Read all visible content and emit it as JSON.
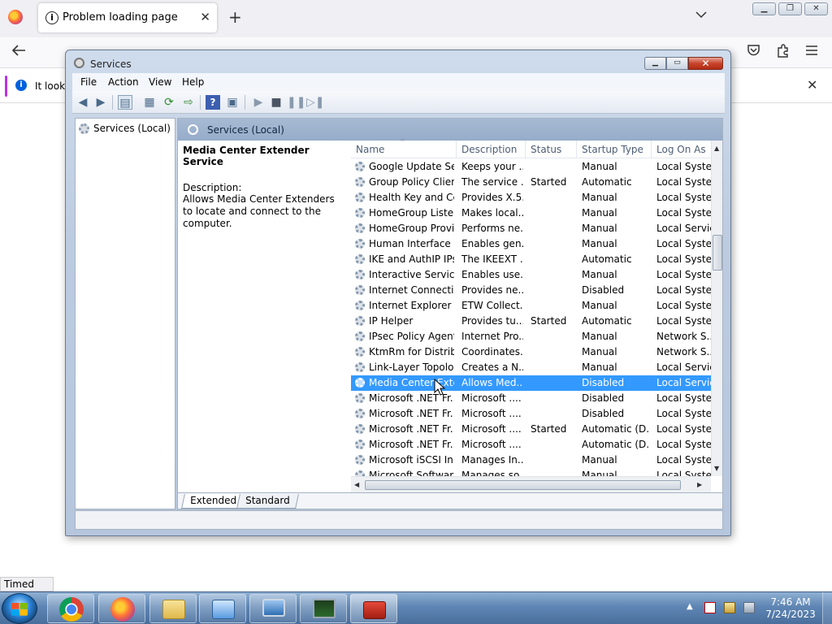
{
  "firefox": {
    "tab_title": "Problem loading page",
    "tab_close": "✕",
    "new_tab": "+",
    "notice_text": "It looks",
    "status_text": "Timed Out"
  },
  "window_buttons": {
    "minimize": "▁",
    "maximize": "❐",
    "close": "✕"
  },
  "services_window": {
    "title": "Services",
    "caption": {
      "minimize": "▁",
      "maximize": "▭",
      "close": "✕"
    },
    "menu": [
      "File",
      "Action",
      "View",
      "Help"
    ],
    "tree_item": "Services (Local)",
    "panel_header": "Services (Local)",
    "selected_service": {
      "name": "Media Center Extender Service",
      "description_label": "Description:",
      "description": "Allows Media Center Extenders to locate and connect to the computer."
    },
    "columns": [
      "Name",
      "Description",
      "Status",
      "Startup Type",
      "Log On As"
    ],
    "rows": [
      {
        "name": "Google Update Se...",
        "description": "Keeps your ...",
        "status": "",
        "startup": "Manual",
        "logon": "Local Syste..."
      },
      {
        "name": "Group Policy Client",
        "description": "The service ...",
        "status": "Started",
        "startup": "Automatic",
        "logon": "Local Syste..."
      },
      {
        "name": "Health Key and Ce...",
        "description": "Provides X.5...",
        "status": "",
        "startup": "Manual",
        "logon": "Local Syste..."
      },
      {
        "name": "HomeGroup Liste...",
        "description": "Makes local...",
        "status": "",
        "startup": "Manual",
        "logon": "Local Syste..."
      },
      {
        "name": "HomeGroup Provi...",
        "description": "Performs ne...",
        "status": "",
        "startup": "Manual",
        "logon": "Local Servic"
      },
      {
        "name": "Human Interface ...",
        "description": "Enables gen...",
        "status": "",
        "startup": "Manual",
        "logon": "Local Syste..."
      },
      {
        "name": "IKE and AuthIP IPs...",
        "description": "The IKEEXT ...",
        "status": "",
        "startup": "Automatic",
        "logon": "Local Syste..."
      },
      {
        "name": "Interactive Service...",
        "description": "Enables use...",
        "status": "",
        "startup": "Manual",
        "logon": "Local Syste..."
      },
      {
        "name": "Internet Connecti...",
        "description": "Provides ne...",
        "status": "",
        "startup": "Disabled",
        "logon": "Local Syste..."
      },
      {
        "name": "Internet Explorer E...",
        "description": "ETW Collect...",
        "status": "",
        "startup": "Manual",
        "logon": "Local Syste..."
      },
      {
        "name": "IP Helper",
        "description": "Provides tu...",
        "status": "Started",
        "startup": "Automatic",
        "logon": "Local Syste..."
      },
      {
        "name": "IPsec Policy Agent",
        "description": "Internet Pro...",
        "status": "",
        "startup": "Manual",
        "logon": "Network S..."
      },
      {
        "name": "KtmRm for Distrib...",
        "description": "Coordinates...",
        "status": "",
        "startup": "Manual",
        "logon": "Network S..."
      },
      {
        "name": "Link-Layer Topolo...",
        "description": "Creates a N...",
        "status": "",
        "startup": "Manual",
        "logon": "Local Servic"
      },
      {
        "name": "Media Center Exte...",
        "description": "Allows Med...",
        "status": "",
        "startup": "Disabled",
        "logon": "Local Servic",
        "selected": true
      },
      {
        "name": "Microsoft .NET Fr...",
        "description": "Microsoft ....",
        "status": "",
        "startup": "Disabled",
        "logon": "Local Syste..."
      },
      {
        "name": "Microsoft .NET Fr...",
        "description": "Microsoft ....",
        "status": "",
        "startup": "Disabled",
        "logon": "Local Syste..."
      },
      {
        "name": "Microsoft .NET Fr...",
        "description": "Microsoft ....",
        "status": "Started",
        "startup": "Automatic (D...",
        "logon": "Local Syste..."
      },
      {
        "name": "Microsoft .NET Fr...",
        "description": "Microsoft ....",
        "status": "",
        "startup": "Automatic (D...",
        "logon": "Local Syste..."
      },
      {
        "name": "Microsoft iSCSI Ini...",
        "description": "Manages In...",
        "status": "",
        "startup": "Manual",
        "logon": "Local Syste..."
      },
      {
        "name": "Microsoft Softwar...",
        "description": "Manages so...",
        "status": "",
        "startup": "Manual",
        "logon": "Local Syste..."
      }
    ],
    "view_tabs": [
      "Extended",
      "Standard"
    ]
  },
  "taskbar": {
    "apps": [
      "chrome-icon",
      "firefox-icon",
      "explorer-icon",
      "control-panel-icon",
      "remote-desktop-icon",
      "task-manager-icon",
      "toolbox-icon"
    ],
    "time": "7:46 AM",
    "date": "7/24/2023"
  }
}
